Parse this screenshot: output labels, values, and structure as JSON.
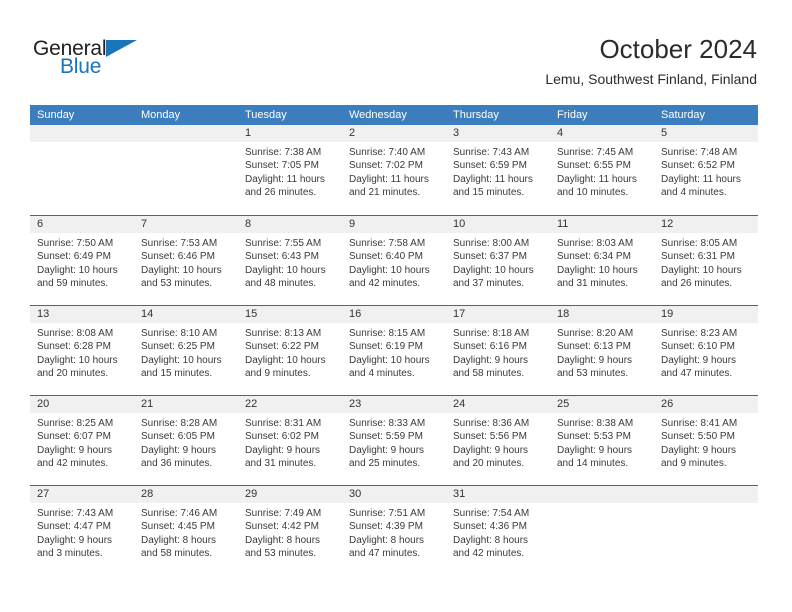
{
  "brand": {
    "name_part1": "General",
    "name_part2": "Blue",
    "flag_icon": "blue-triangle-flag-icon",
    "color_primary": "#1b75bb",
    "color_text": "#231f20"
  },
  "header": {
    "title": "October 2024",
    "subtitle": "Lemu, Southwest Finland, Finland"
  },
  "theme": {
    "header_blue": "#3c7ebd",
    "week_divider": "#2e6da4",
    "numbar_gray": "#f0f0f0",
    "text_dark": "#333333"
  },
  "calendar": {
    "weekday_headers": [
      "Sunday",
      "Monday",
      "Tuesday",
      "Wednesday",
      "Thursday",
      "Friday",
      "Saturday"
    ],
    "weeks": [
      [
        {
          "day": "",
          "sunrise": "",
          "sunset": "",
          "daylight": ""
        },
        {
          "day": "",
          "sunrise": "",
          "sunset": "",
          "daylight": ""
        },
        {
          "day": "1",
          "sunrise": "Sunrise: 7:38 AM",
          "sunset": "Sunset: 7:05 PM",
          "daylight": "Daylight: 11 hours and 26 minutes."
        },
        {
          "day": "2",
          "sunrise": "Sunrise: 7:40 AM",
          "sunset": "Sunset: 7:02 PM",
          "daylight": "Daylight: 11 hours and 21 minutes."
        },
        {
          "day": "3",
          "sunrise": "Sunrise: 7:43 AM",
          "sunset": "Sunset: 6:59 PM",
          "daylight": "Daylight: 11 hours and 15 minutes."
        },
        {
          "day": "4",
          "sunrise": "Sunrise: 7:45 AM",
          "sunset": "Sunset: 6:55 PM",
          "daylight": "Daylight: 11 hours and 10 minutes."
        },
        {
          "day": "5",
          "sunrise": "Sunrise: 7:48 AM",
          "sunset": "Sunset: 6:52 PM",
          "daylight": "Daylight: 11 hours and 4 minutes."
        }
      ],
      [
        {
          "day": "6",
          "sunrise": "Sunrise: 7:50 AM",
          "sunset": "Sunset: 6:49 PM",
          "daylight": "Daylight: 10 hours and 59 minutes."
        },
        {
          "day": "7",
          "sunrise": "Sunrise: 7:53 AM",
          "sunset": "Sunset: 6:46 PM",
          "daylight": "Daylight: 10 hours and 53 minutes."
        },
        {
          "day": "8",
          "sunrise": "Sunrise: 7:55 AM",
          "sunset": "Sunset: 6:43 PM",
          "daylight": "Daylight: 10 hours and 48 minutes."
        },
        {
          "day": "9",
          "sunrise": "Sunrise: 7:58 AM",
          "sunset": "Sunset: 6:40 PM",
          "daylight": "Daylight: 10 hours and 42 minutes."
        },
        {
          "day": "10",
          "sunrise": "Sunrise: 8:00 AM",
          "sunset": "Sunset: 6:37 PM",
          "daylight": "Daylight: 10 hours and 37 minutes."
        },
        {
          "day": "11",
          "sunrise": "Sunrise: 8:03 AM",
          "sunset": "Sunset: 6:34 PM",
          "daylight": "Daylight: 10 hours and 31 minutes."
        },
        {
          "day": "12",
          "sunrise": "Sunrise: 8:05 AM",
          "sunset": "Sunset: 6:31 PM",
          "daylight": "Daylight: 10 hours and 26 minutes."
        }
      ],
      [
        {
          "day": "13",
          "sunrise": "Sunrise: 8:08 AM",
          "sunset": "Sunset: 6:28 PM",
          "daylight": "Daylight: 10 hours and 20 minutes."
        },
        {
          "day": "14",
          "sunrise": "Sunrise: 8:10 AM",
          "sunset": "Sunset: 6:25 PM",
          "daylight": "Daylight: 10 hours and 15 minutes."
        },
        {
          "day": "15",
          "sunrise": "Sunrise: 8:13 AM",
          "sunset": "Sunset: 6:22 PM",
          "daylight": "Daylight: 10 hours and 9 minutes."
        },
        {
          "day": "16",
          "sunrise": "Sunrise: 8:15 AM",
          "sunset": "Sunset: 6:19 PM",
          "daylight": "Daylight: 10 hours and 4 minutes."
        },
        {
          "day": "17",
          "sunrise": "Sunrise: 8:18 AM",
          "sunset": "Sunset: 6:16 PM",
          "daylight": "Daylight: 9 hours and 58 minutes."
        },
        {
          "day": "18",
          "sunrise": "Sunrise: 8:20 AM",
          "sunset": "Sunset: 6:13 PM",
          "daylight": "Daylight: 9 hours and 53 minutes."
        },
        {
          "day": "19",
          "sunrise": "Sunrise: 8:23 AM",
          "sunset": "Sunset: 6:10 PM",
          "daylight": "Daylight: 9 hours and 47 minutes."
        }
      ],
      [
        {
          "day": "20",
          "sunrise": "Sunrise: 8:25 AM",
          "sunset": "Sunset: 6:07 PM",
          "daylight": "Daylight: 9 hours and 42 minutes."
        },
        {
          "day": "21",
          "sunrise": "Sunrise: 8:28 AM",
          "sunset": "Sunset: 6:05 PM",
          "daylight": "Daylight: 9 hours and 36 minutes."
        },
        {
          "day": "22",
          "sunrise": "Sunrise: 8:31 AM",
          "sunset": "Sunset: 6:02 PM",
          "daylight": "Daylight: 9 hours and 31 minutes."
        },
        {
          "day": "23",
          "sunrise": "Sunrise: 8:33 AM",
          "sunset": "Sunset: 5:59 PM",
          "daylight": "Daylight: 9 hours and 25 minutes."
        },
        {
          "day": "24",
          "sunrise": "Sunrise: 8:36 AM",
          "sunset": "Sunset: 5:56 PM",
          "daylight": "Daylight: 9 hours and 20 minutes."
        },
        {
          "day": "25",
          "sunrise": "Sunrise: 8:38 AM",
          "sunset": "Sunset: 5:53 PM",
          "daylight": "Daylight: 9 hours and 14 minutes."
        },
        {
          "day": "26",
          "sunrise": "Sunrise: 8:41 AM",
          "sunset": "Sunset: 5:50 PM",
          "daylight": "Daylight: 9 hours and 9 minutes."
        }
      ],
      [
        {
          "day": "27",
          "sunrise": "Sunrise: 7:43 AM",
          "sunset": "Sunset: 4:47 PM",
          "daylight": "Daylight: 9 hours and 3 minutes."
        },
        {
          "day": "28",
          "sunrise": "Sunrise: 7:46 AM",
          "sunset": "Sunset: 4:45 PM",
          "daylight": "Daylight: 8 hours and 58 minutes."
        },
        {
          "day": "29",
          "sunrise": "Sunrise: 7:49 AM",
          "sunset": "Sunset: 4:42 PM",
          "daylight": "Daylight: 8 hours and 53 minutes."
        },
        {
          "day": "30",
          "sunrise": "Sunrise: 7:51 AM",
          "sunset": "Sunset: 4:39 PM",
          "daylight": "Daylight: 8 hours and 47 minutes."
        },
        {
          "day": "31",
          "sunrise": "Sunrise: 7:54 AM",
          "sunset": "Sunset: 4:36 PM",
          "daylight": "Daylight: 8 hours and 42 minutes."
        },
        {
          "day": "",
          "sunrise": "",
          "sunset": "",
          "daylight": ""
        },
        {
          "day": "",
          "sunrise": "",
          "sunset": "",
          "daylight": ""
        }
      ]
    ]
  }
}
